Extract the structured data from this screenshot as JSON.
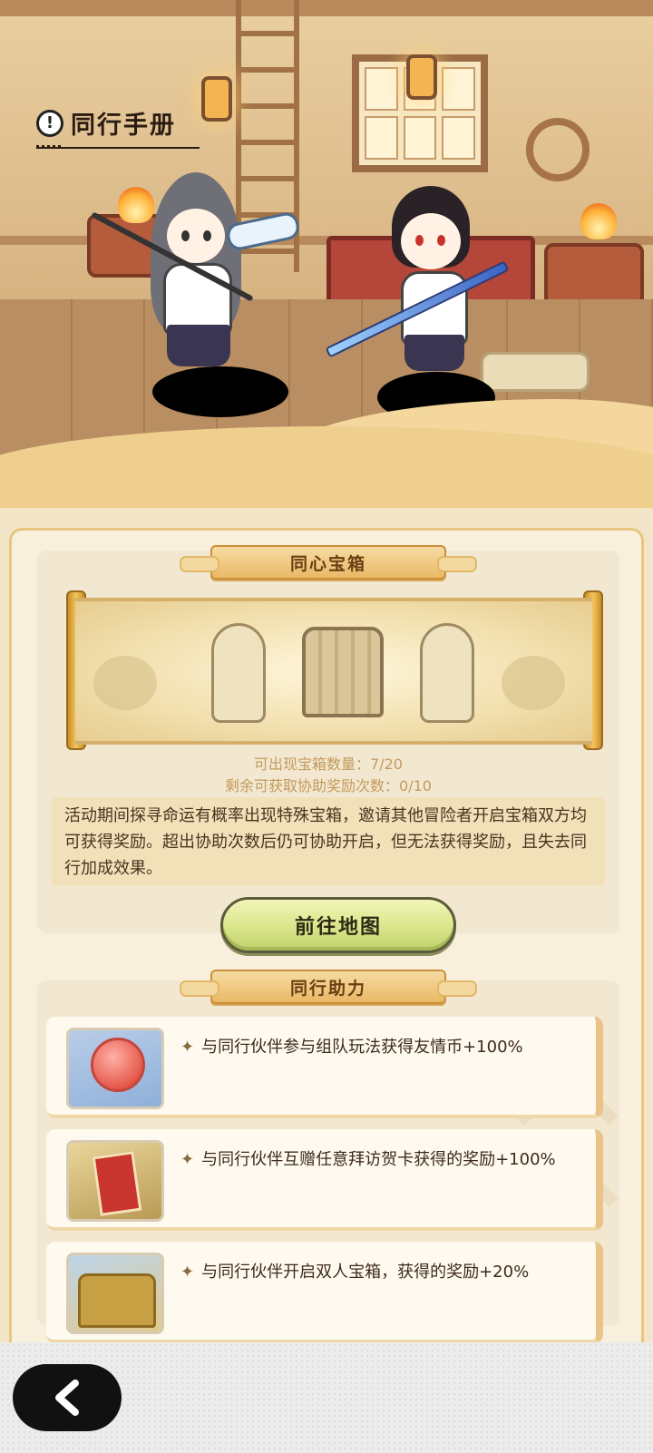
{
  "header": {
    "title": "同行手册",
    "title_icon": "exclamation-circle-icon"
  },
  "chest_section": {
    "ribbon": "同心宝箱",
    "stat_chest_count": "可出现宝箱数量：7/20",
    "stat_assist_remaining": "剩余可获取协助奖励次数：0/10",
    "description": "活动期间探寻命运有概率出现特殊宝箱，邀请其他冒险者开启宝箱双方均可获得奖励。超出协助次数后仍可协助开启，但无法获得奖励，且失去同行加成效果。",
    "go_button": "前往地图"
  },
  "assist_section": {
    "ribbon": "同行助力",
    "items": [
      {
        "icon": "friendship-coin-icon",
        "text": "与同行伙伴参与组队玩法获得友情币+100%"
      },
      {
        "icon": "greeting-card-icon",
        "text": "与同行伙伴互赠任意拜访贺卡获得的奖励+100%"
      },
      {
        "icon": "treasure-chest-icon",
        "text": "与同行伙伴开启双人宝箱，获得的奖励+20%"
      }
    ]
  },
  "nav": {
    "back_icon": "chevron-left-icon"
  },
  "colors": {
    "accent_button": "#d9e58a",
    "ribbon": "#e9b866",
    "panel_bg": "#f8f0dc",
    "stat_text": "#c39a5b"
  }
}
